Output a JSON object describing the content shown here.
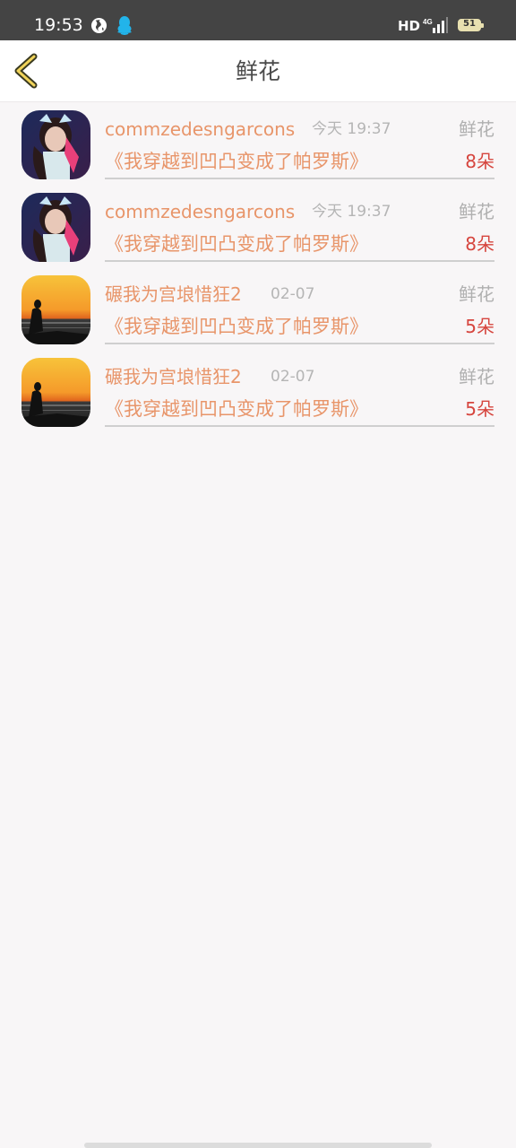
{
  "status_bar": {
    "time": "19:53",
    "network": "HD",
    "signal_label": "4G",
    "battery_level": "51"
  },
  "nav": {
    "title": "鲜花"
  },
  "items": [
    {
      "user": "commzedesngarcons",
      "time": "今天 19:37",
      "type": "鲜花",
      "book": "《我穿越到凹凸变成了帕罗斯》",
      "count": "8朵",
      "avatar_icon": "girl-portrait-avatar"
    },
    {
      "user": "commzedesngarcons",
      "time": "今天 19:37",
      "type": "鲜花",
      "book": "《我穿越到凹凸变成了帕罗斯》",
      "count": "8朵",
      "avatar_icon": "girl-portrait-avatar"
    },
    {
      "user": "碾我为宫埌惜狂2",
      "time": "02-07",
      "type": "鲜花",
      "book": "《我穿越到凹凸变成了帕罗斯》",
      "count": "5朵",
      "avatar_icon": "sunset-silhouette-avatar"
    },
    {
      "user": "碾我为宫埌惜狂2",
      "time": "02-07",
      "type": "鲜花",
      "book": "《我穿越到凹凸变成了帕罗斯》",
      "count": "5朵",
      "avatar_icon": "sunset-silhouette-avatar"
    }
  ],
  "colors": {
    "accent": "#e8956a",
    "count": "#d6453e",
    "muted": "#b0b0b0",
    "background": "#f8f6f7"
  }
}
